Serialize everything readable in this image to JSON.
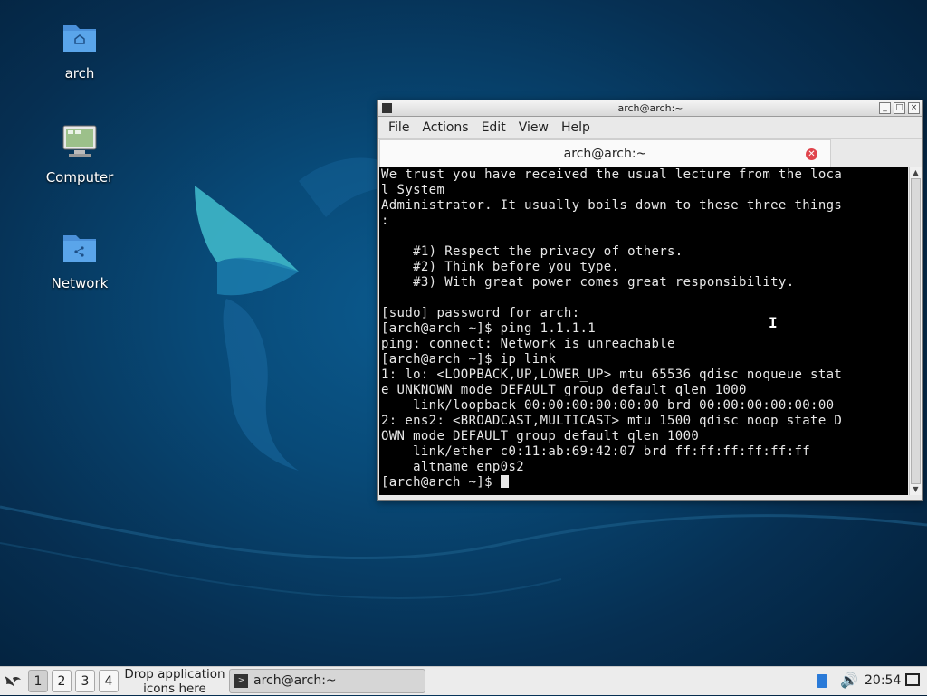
{
  "desktop": {
    "icons": [
      {
        "label": "arch",
        "icon": "home-folder-icon"
      },
      {
        "label": "Computer",
        "icon": "computer-icon"
      },
      {
        "label": "Network",
        "icon": "network-folder-icon"
      }
    ]
  },
  "window": {
    "title": "arch@arch:~",
    "menu": [
      "File",
      "Actions",
      "Edit",
      "View",
      "Help"
    ],
    "tab_title": "arch@arch:~",
    "terminal_lines": [
      "We trust you have received the usual lecture from the loca",
      "l System",
      "Administrator. It usually boils down to these three things",
      ":",
      "",
      "    #1) Respect the privacy of others.",
      "    #2) Think before you type.",
      "    #3) With great power comes great responsibility.",
      "",
      "[sudo] password for arch:",
      "[arch@arch ~]$ ping 1.1.1.1",
      "ping: connect: Network is unreachable",
      "[arch@arch ~]$ ip link",
      "1: lo: <LOOPBACK,UP,LOWER_UP> mtu 65536 qdisc noqueue stat",
      "e UNKNOWN mode DEFAULT group default qlen 1000",
      "    link/loopback 00:00:00:00:00:00 brd 00:00:00:00:00:00",
      "2: ens2: <BROADCAST,MULTICAST> mtu 1500 qdisc noop state D",
      "OWN mode DEFAULT group default qlen 1000",
      "    link/ether c0:11:ab:69:42:07 brd ff:ff:ff:ff:ff:ff",
      "    altname enp0s2"
    ],
    "prompt": "[arch@arch ~]$ "
  },
  "taskbar": {
    "workspaces": [
      "1",
      "2",
      "3",
      "4"
    ],
    "drop_hint": "Drop application icons here",
    "task_label": "arch@arch:~",
    "clock": "20:54"
  },
  "colors": {
    "accent_red": "#e0444c",
    "wallpaper": "#084a78",
    "terminal_bg": "#000000"
  }
}
